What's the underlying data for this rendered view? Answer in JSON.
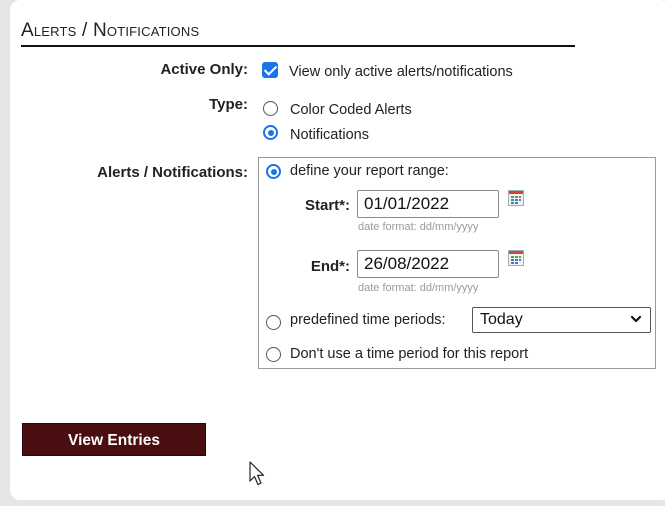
{
  "section": {
    "title": "Alerts / Notifications"
  },
  "active_only": {
    "label": "Active Only:",
    "checkbox_text": "View only active alerts/notifications",
    "checked": true
  },
  "type": {
    "label": "Type:",
    "options": [
      {
        "text": "Color Coded Alerts",
        "selected": false
      },
      {
        "text": "Notifications",
        "selected": true
      }
    ]
  },
  "range": {
    "label": "Alerts / Notifications:",
    "define_text": "define your report range:",
    "start_label": "Start*:",
    "start_value": "01/01/2022",
    "end_label": "End*:",
    "end_value": "26/08/2022",
    "date_hint": "date format: dd/mm/yyyy",
    "predefined_text": "predefined time periods:",
    "predefined_selected": "Today",
    "no_period_text": "Don't use a time period for this report",
    "selected_option": "define"
  },
  "actions": {
    "view_entries": "View Entries"
  },
  "colors": {
    "accent": "#1a73e8",
    "button_bg": "#4a0d10",
    "hint": "#9a9a9a"
  },
  "icons": {
    "calendar": "calendar-icon",
    "dropdown": "chevron-down-icon",
    "pointer": "mouse-pointer-icon"
  }
}
